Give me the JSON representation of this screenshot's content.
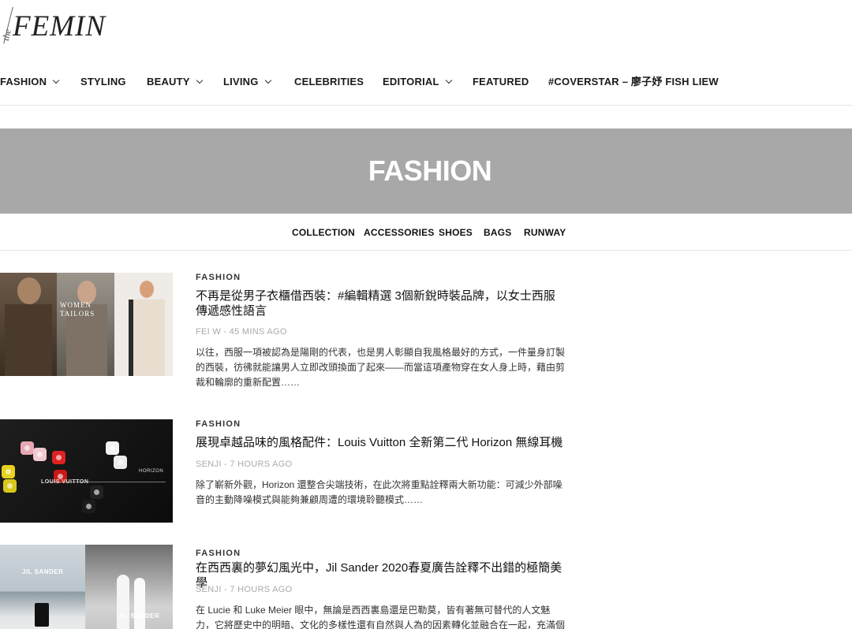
{
  "site": {
    "logo_prefix": "the",
    "logo_name": "FEMIN"
  },
  "nav": {
    "items": [
      {
        "label": "FASHION",
        "dropdown": true
      },
      {
        "label": "STYLING",
        "dropdown": false
      },
      {
        "label": "BEAUTY",
        "dropdown": true
      },
      {
        "label": "LIVING",
        "dropdown": true
      },
      {
        "label": "CELEBRITIES",
        "dropdown": false
      },
      {
        "label": "EDITORIAL",
        "dropdown": true
      },
      {
        "label": "FEATURED",
        "dropdown": false
      },
      {
        "label": "#COVERSTAR – 廖子妤 FISH LIEW",
        "dropdown": false
      }
    ]
  },
  "banner": {
    "title": "FASHION",
    "background": "#a8a8a8"
  },
  "subnav": {
    "items": [
      "COLLECTION",
      "ACCESSORIES",
      "SHOES",
      "BAGS",
      "RUNWAY"
    ]
  },
  "posts": [
    {
      "category": "FASHION",
      "title": "不再是從男子衣櫃借西裝：#編輯精選 3個新銳時裝品牌，以女士西服傳遞感性語言",
      "meta": "FEI W - 45 MINS AGO",
      "excerpt": "以往，西服一項被認為是陽剛的代表，也是男人彰顯自我風格最好的方式，一件量身訂製的西裝，彷彿就能讓男人立即改頭換面了起來——而當這項產物穿在女人身上時，藉由剪裁和輪廓的重新配置……",
      "thumb_text": "WOMEN TAILORS"
    },
    {
      "category": "FASHION",
      "title": "展現卓越品味的風格配件：Louis Vuitton 全新第二代 Horizon 無線耳機",
      "meta": "SENJI - 7 HOURS AGO",
      "excerpt": "除了嶄新外觀，Horizon 還整合尖端技術，在此次將重點詮釋兩大新功能：可減少外部噪音的主動降噪模式與能夠兼顧周遭的環境聆聽模式……",
      "thumb_text_1": "LOUIS VUITTON",
      "thumb_text_2": "HORIZON"
    },
    {
      "category": "FASHION",
      "title": "在西西裏的夢幻風光中，Jil Sander 2020春夏廣告詮釋不出錯的極簡美學",
      "meta": "SENJI - 7 HOURS AGO",
      "excerpt": "在 Lucie 和 Luke Meier 眼中，無論是西西裏島還是巴勒莫，皆有著無可替代的人文魅力，它將歷史中的明暗、文化的多樣性還有自然與人為的因素轉化並融合在一起，充滿個",
      "thumb_text_1": "JIL SANDER",
      "thumb_text_2": "JIL SANDER"
    }
  ]
}
